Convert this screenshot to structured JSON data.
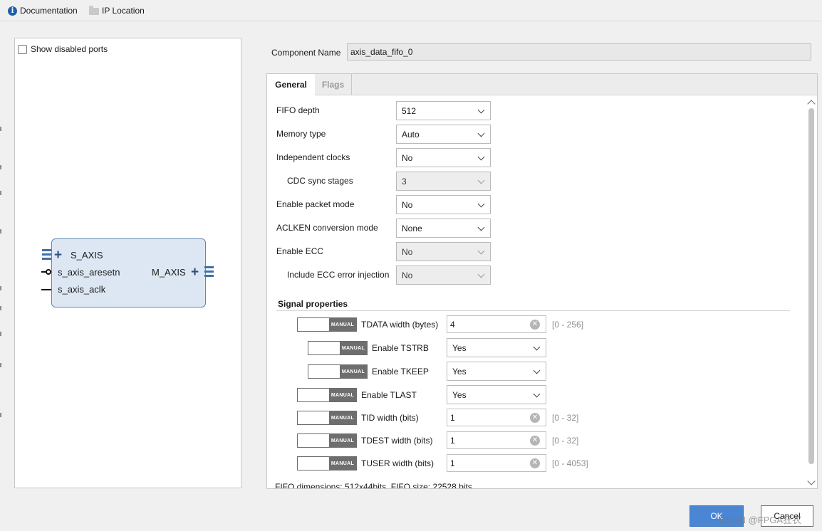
{
  "toolbar": {
    "documentation": "Documentation",
    "ip_location": "IP Location"
  },
  "left_panel": {
    "show_disabled_ports": "Show disabled ports",
    "ports": {
      "s_axis": "S_AXIS",
      "s_axis_aresetn": "s_axis_aresetn",
      "s_axis_aclk": "s_axis_aclk",
      "m_axis": "M_AXIS"
    }
  },
  "component": {
    "label": "Component Name",
    "value": "axis_data_fifo_0"
  },
  "tabs": [
    {
      "label": "General",
      "active": true
    },
    {
      "label": "Flags",
      "active": false
    }
  ],
  "general": {
    "fifo_depth": {
      "label": "FIFO depth",
      "value": "512"
    },
    "memory_type": {
      "label": "Memory type",
      "value": "Auto"
    },
    "independent_clocks": {
      "label": "Independent clocks",
      "value": "No"
    },
    "cdc_sync_stages": {
      "label": "CDC sync stages",
      "value": "3"
    },
    "enable_packet_mode": {
      "label": "Enable packet mode",
      "value": "No"
    },
    "aclken_conversion_mode": {
      "label": "ACLKEN conversion mode",
      "value": "None"
    },
    "enable_ecc": {
      "label": "Enable ECC",
      "value": "No"
    },
    "include_ecc_error_injection": {
      "label": "Include ECC error injection",
      "value": "No"
    }
  },
  "signal_properties": {
    "title": "Signal properties",
    "manual_label": "MANUAL",
    "tdata_width": {
      "label": "TDATA width (bytes)",
      "value": "4",
      "range": "[0 - 256]"
    },
    "enable_tstrb": {
      "label": "Enable TSTRB",
      "value": "Yes"
    },
    "enable_tkeep": {
      "label": "Enable TKEEP",
      "value": "Yes"
    },
    "enable_tlast": {
      "label": "Enable TLAST",
      "value": "Yes"
    },
    "tid_width": {
      "label": "TID width (bits)",
      "value": "1",
      "range": "[0 - 32]"
    },
    "tdest_width": {
      "label": "TDEST width (bits)",
      "value": "1",
      "range": "[0 - 32]"
    },
    "tuser_width": {
      "label": "TUSER width (bits)",
      "value": "1",
      "range": "[0 - 4053]"
    }
  },
  "footer": {
    "dimensions": "FIFO dimensions: 512x44bits, FIFO size: 22528 bits",
    "ok": "OK",
    "cancel": "Cancel",
    "watermark": "CSDN @FPGA狂农"
  },
  "colors": {
    "accent": "#4a86d4",
    "block_fill": "#dde7f3",
    "block_border": "#5e87b5"
  }
}
